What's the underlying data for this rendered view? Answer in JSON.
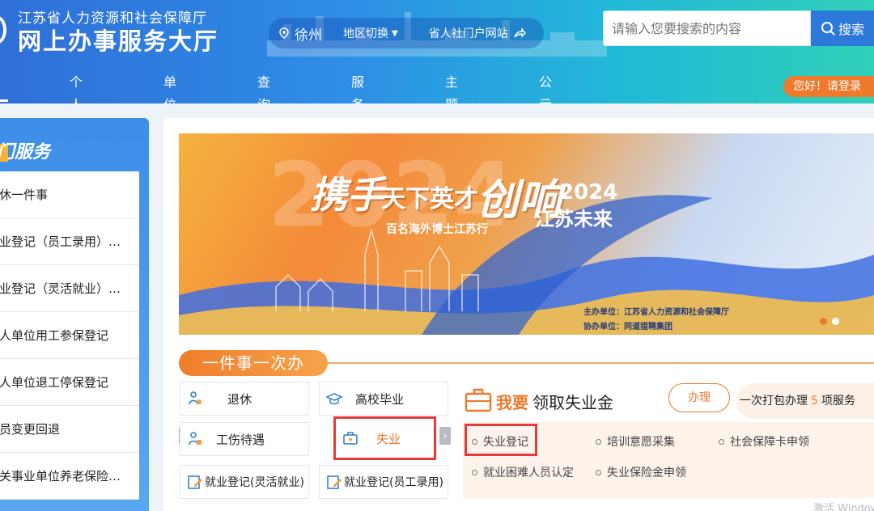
{
  "header": {
    "org_name": "江苏省人力资源和社会保障厅",
    "site_name": "网上办事服务大厅",
    "city": "徐州",
    "region_switch": "地区切换",
    "portal_link": "省人社门户网站",
    "search_placeholder": "请输入您要搜索的内容",
    "search_button": "搜索",
    "login": "您好！请登录"
  },
  "nav": {
    "items": [
      {
        "label": "首页"
      },
      {
        "label": "个人办事"
      },
      {
        "label": "单位办事"
      },
      {
        "label": "查询服务"
      },
      {
        "label": "服务清单"
      },
      {
        "label": "主题服务"
      },
      {
        "label": "公示公告"
      }
    ]
  },
  "left_panel": {
    "title": "热门服务",
    "items": [
      {
        "label": "退休一件事"
      },
      {
        "label": "就业登记（员工录用）…"
      },
      {
        "label": "就业登记（灵活就业）…"
      },
      {
        "label": "个人单位用工参保登记"
      },
      {
        "label": "个人单位退工停保登记"
      },
      {
        "label": "人员变更回退"
      },
      {
        "label": "机关事业单位养老保险…"
      }
    ]
  },
  "banner": {
    "bg_year": "2024",
    "slogan_a": "携手",
    "slogan_b": "天下英才",
    "slogan_c": "创响",
    "slogan_year": "2024",
    "slogan_d": "江苏未来",
    "subtitle": "百名海外博士江苏行",
    "host": "主办单位：江苏省人力资源和社会保障厅",
    "co_host": "协办单位：同道猎聘集团"
  },
  "one_thing": {
    "tab_label": "一件事一次办",
    "tiles": [
      {
        "label": "退休"
      },
      {
        "label": "高校毕业"
      },
      {
        "label": "工伤待遇"
      },
      {
        "label": "失业"
      },
      {
        "label": "就业登记(灵活就业)"
      },
      {
        "label": "就业登记(员工录用)"
      }
    ],
    "detail": {
      "title_prefix": "我要",
      "title_main": "领取失业金",
      "action": "办理",
      "pack_prefix": "一次打包办理",
      "pack_count": "5",
      "pack_suffix": "项服务",
      "links": [
        {
          "label": "失业登记"
        },
        {
          "label": "培训意愿采集"
        },
        {
          "label": "社会保障卡申领"
        },
        {
          "label": "就业困难人员认定"
        },
        {
          "label": "失业保险金申领"
        }
      ]
    }
  },
  "watermark": "激活 Windows",
  "colors": {
    "primary": "#2c79d9",
    "accent": "#f0792c",
    "highlight": "#e53a3a"
  }
}
